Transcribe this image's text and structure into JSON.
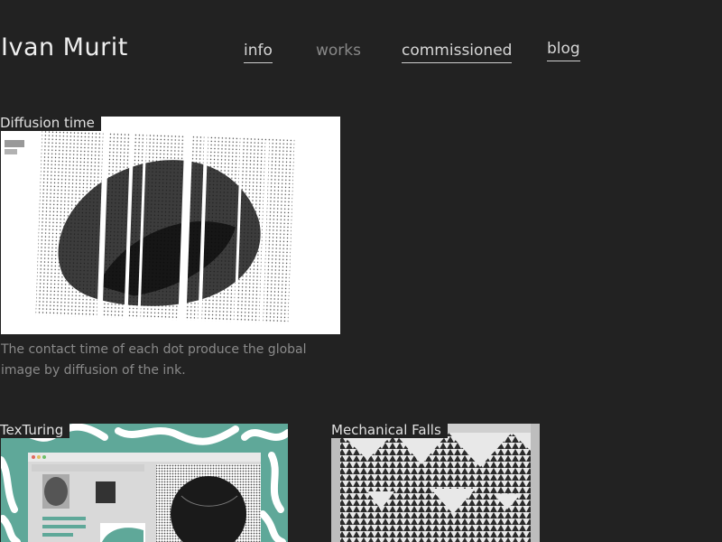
{
  "header": {
    "site_title": "Ivan Murit",
    "nav": [
      {
        "label": "info"
      },
      {
        "label": "works"
      },
      {
        "label": "commissioned"
      },
      {
        "label": "blog"
      }
    ]
  },
  "projects": [
    {
      "title": "Diffusion time",
      "description": "The contact time of each dot produce the global image by diffusion of the ink."
    },
    {
      "title": "TexTuring"
    },
    {
      "title": "Mechanical Falls"
    }
  ],
  "colors": {
    "background": "#222222",
    "text": "#eeeeee",
    "muted": "#888888",
    "teal": "#5fa899"
  }
}
